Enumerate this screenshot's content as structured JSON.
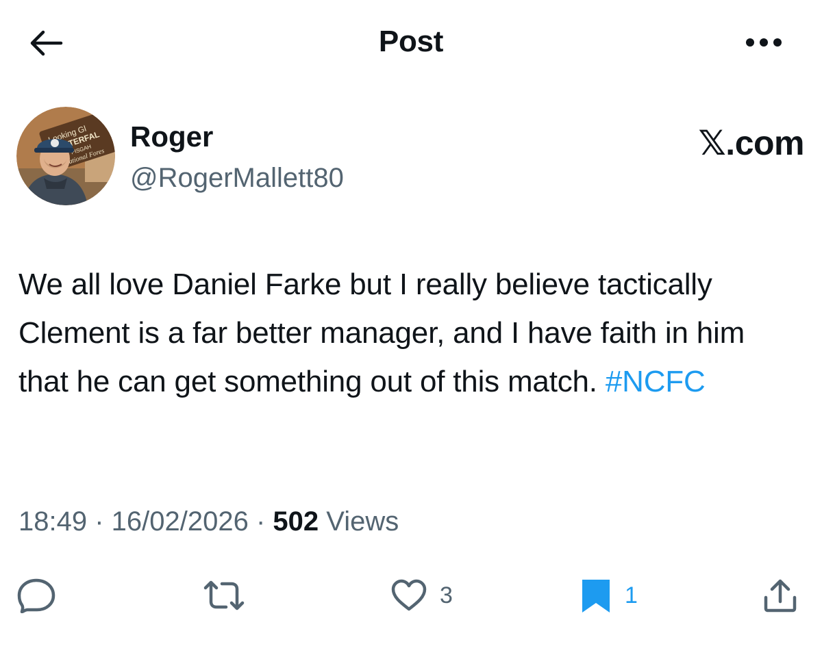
{
  "header": {
    "title": "Post",
    "back_icon": "arrow-left-icon",
    "more_icon": "more-horizontal-icon"
  },
  "author": {
    "display_name": "Roger",
    "handle": "@RogerMallett80",
    "avatar_sign_text": [
      "Looking Gl",
      "WATERFAL",
      "PISGAH",
      "National Fores"
    ]
  },
  "watermark": "𝕏.com",
  "tweet": {
    "text": "We all love Daniel Farke but I really believe tactically Clement is a far better manager, and I have faith in him that he can get something out of this match. ",
    "hashtag": "#NCFC"
  },
  "meta": {
    "time": "18:49",
    "separator": " · ",
    "date": "16/02/2026",
    "views_count": "502",
    "views_label": "Views"
  },
  "actions": {
    "reply": {
      "icon": "reply-icon"
    },
    "repost": {
      "icon": "repost-icon"
    },
    "like": {
      "icon": "heart-icon",
      "count": "3"
    },
    "bookmark": {
      "icon": "bookmark-icon",
      "count": "1"
    },
    "share": {
      "icon": "share-icon"
    }
  },
  "colors": {
    "text": "#0f1419",
    "secondary": "#536471",
    "accent": "#1d9bf0"
  }
}
